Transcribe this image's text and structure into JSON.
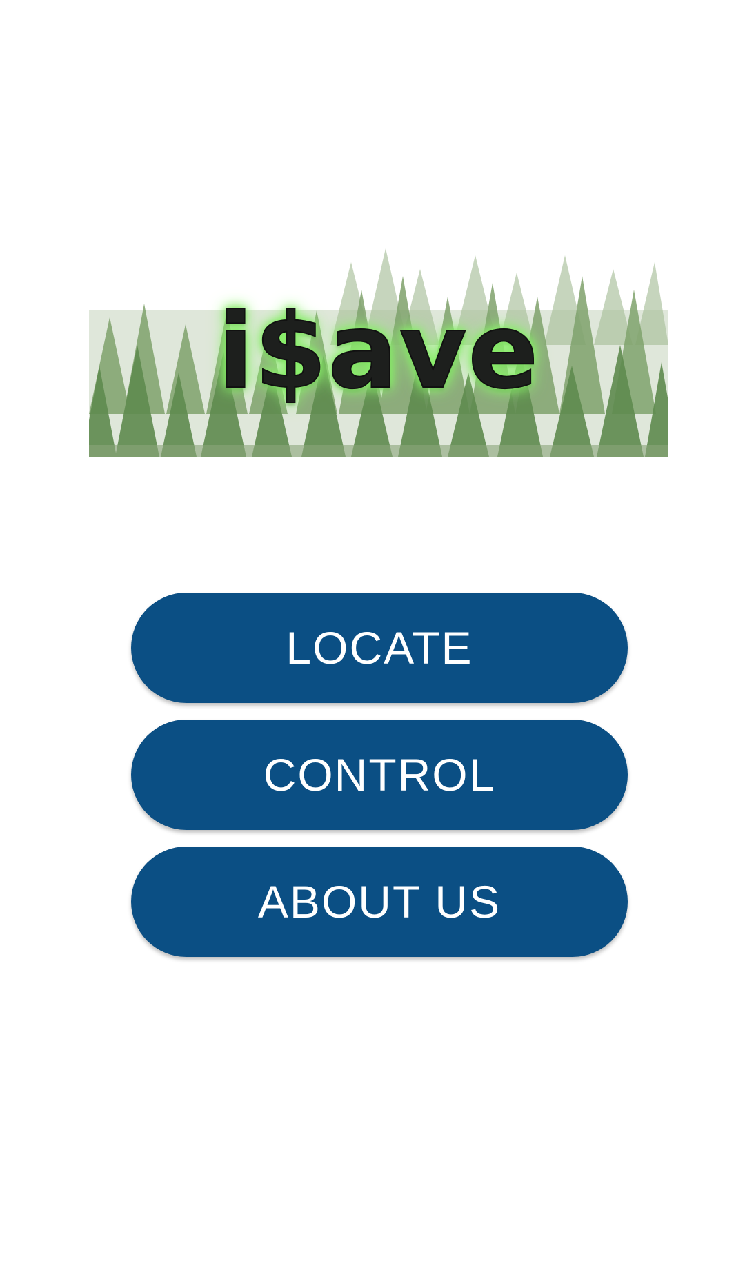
{
  "app": {
    "logo_text": "i$ave",
    "logo_image": "forest-banner"
  },
  "menu": {
    "buttons": [
      {
        "label": "LOCATE"
      },
      {
        "label": "CONTROL"
      },
      {
        "label": "ABOUT US"
      }
    ]
  },
  "colors": {
    "button_background": "#0b4f84",
    "button_text": "#ffffff",
    "logo_glow": "#7ee85e",
    "page_background": "#ffffff"
  }
}
